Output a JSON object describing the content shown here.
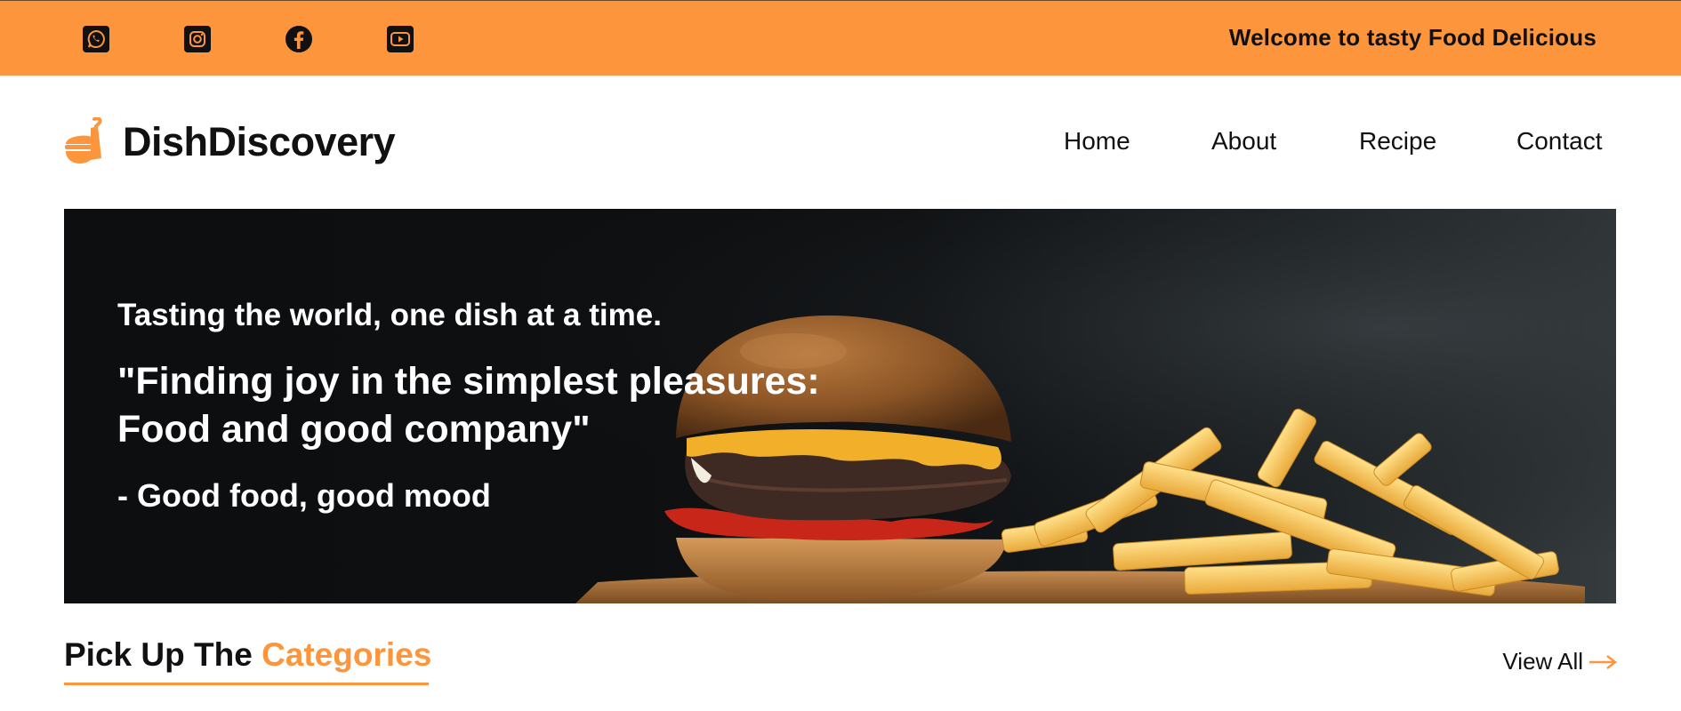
{
  "colors": {
    "accent": "#fd953d",
    "dark": "#111111",
    "hero_bg": "#0e1012",
    "white": "#ffffff"
  },
  "topbar": {
    "social_icons": [
      "whatsapp-icon",
      "instagram-icon",
      "facebook-icon",
      "youtube-icon"
    ],
    "welcome_text": "Welcome to tasty Food Delicious"
  },
  "header": {
    "logo_icon": "food-bowl-icon",
    "brand": "DishDiscovery",
    "nav": [
      {
        "label": "Home"
      },
      {
        "label": "About"
      },
      {
        "label": "Recipe"
      },
      {
        "label": "Contact"
      }
    ]
  },
  "hero": {
    "tagline": "Tasting the world, one dish at a time.",
    "quote_line1": "\"Finding joy in the simplest pleasures:",
    "quote_line2": "Food and good company\"",
    "signature": "- Good food, good mood",
    "image": "burger-and-fries-photo"
  },
  "categories": {
    "heading_prefix": "Pick Up The",
    "heading_accent": "Categories",
    "view_all_label": "View All",
    "view_all_icon": "arrow-right-icon"
  }
}
